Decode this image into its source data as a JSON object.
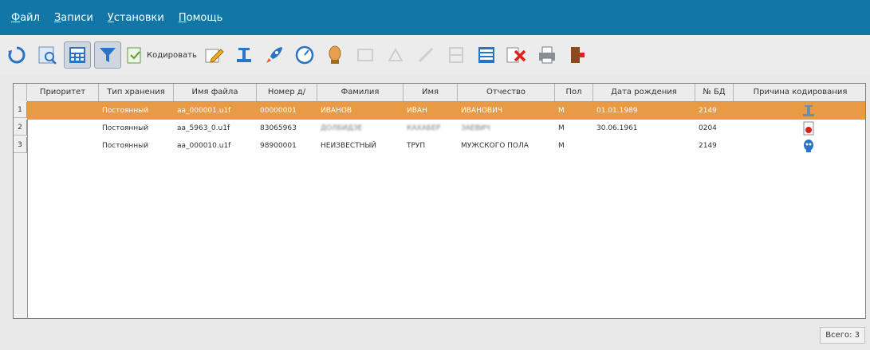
{
  "menu": [
    "Файл",
    "Записи",
    "Установки",
    "Помощь"
  ],
  "toolbar": {
    "encode_label": "Кодировать",
    "icons": [
      "refresh-icon",
      "search-icon",
      "calculator-icon",
      "filter-icon",
      "encode-icon",
      "edit-icon",
      "scale-icon",
      "rocket-icon",
      "compass-icon",
      "person-icon",
      "disabled-icon-1",
      "disabled-icon-2",
      "disabled-icon-3",
      "table-icon",
      "list-icon",
      "delete-icon",
      "print-icon",
      "exit-icon"
    ]
  },
  "table": {
    "columns": [
      "Приоритет",
      "Тип хранения",
      "Имя файла",
      "Номер д/",
      "Фамилия",
      "Имя",
      "Отчество",
      "Пол",
      "Дата рождения",
      "№ БД",
      "Причина кодирования"
    ],
    "rows": [
      {
        "num": "1",
        "priority": "",
        "storage": "Постоянный",
        "file": "aa_000001.u1f",
        "number": "00000001",
        "surname": "ИВАНОВ",
        "name": "ИВАН",
        "patronymic": "ИВАНОВИЧ",
        "sex": "М",
        "birth": "01.01.1989",
        "db": "2149",
        "reason_icon": "scale-icon",
        "selected": true
      },
      {
        "num": "2",
        "priority": "",
        "storage": "Постоянный",
        "file": "aa_5963_0.u1f",
        "number": "83065963",
        "surname": "ДОЛБИДЗЕ",
        "name": "КАХАБЕР",
        "patronymic": "ЗАЕВИЧ",
        "sex": "М",
        "birth": "30.06.1961",
        "db": "0204",
        "reason_icon": "warrant-icon",
        "selected": false
      },
      {
        "num": "3",
        "priority": "",
        "storage": "Постоянный",
        "file": "aa_000010.u1f",
        "number": "98900001",
        "surname": "НЕИЗВЕСТНЫЙ",
        "name": "ТРУП",
        "patronymic": "МУЖСКОГО ПОЛА",
        "sex": "М",
        "birth": "",
        "db": "2149",
        "reason_icon": "skull-icon",
        "selected": false
      }
    ]
  },
  "status": {
    "total": "Всего: 3"
  }
}
